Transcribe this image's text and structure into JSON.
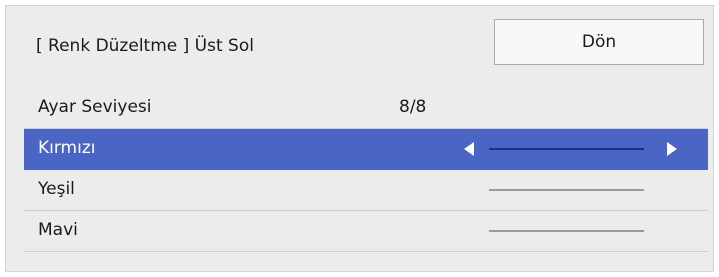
{
  "dialog": {
    "title": "[ Renk Düzeltme ] Üst Sol",
    "back_label": "Dön"
  },
  "rows": [
    {
      "label": "Ayar Seviyesi",
      "value": "8/8"
    },
    {
      "label": "Kırmızı",
      "selected": true
    },
    {
      "label": "Yeşil"
    },
    {
      "label": "Mavi"
    }
  ],
  "icons": {
    "left": "arrow-left-icon",
    "right": "arrow-right-icon"
  },
  "colors": {
    "selection": "#4a65c4",
    "panel": "#ececec"
  }
}
